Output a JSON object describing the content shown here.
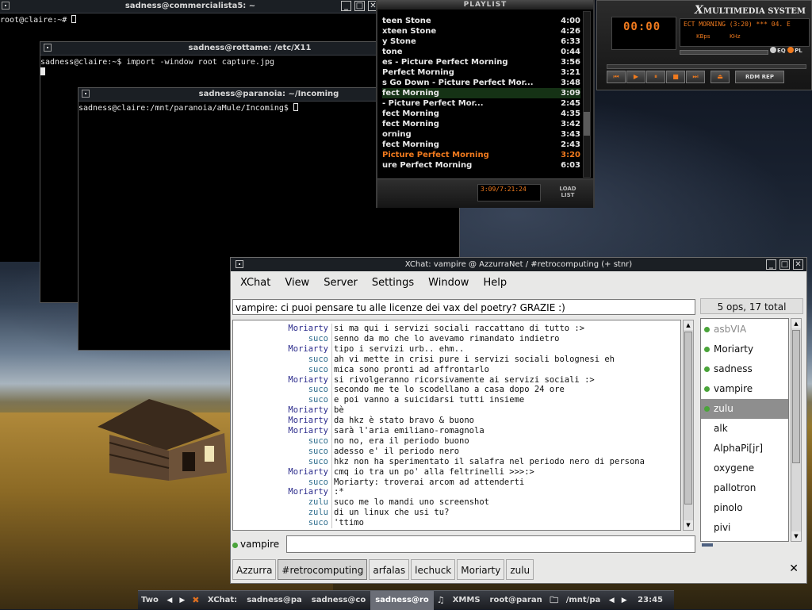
{
  "colors": {
    "accent": "#f07a1e",
    "nick_blue": "#2c2c8c",
    "nick_teal": "#2f6e8e",
    "online_dot": "#4aa43a",
    "titlebar": "#1b1f24"
  },
  "terminals": [
    {
      "title": "sadness@commercialista5: ~",
      "lines": [
        "root@claire:~# "
      ]
    },
    {
      "title": "sadness@rottame: /etc/X11",
      "lines": [
        "sadness@claire:~$ import -window root capture.jpg"
      ]
    },
    {
      "title": "sadness@paranoia: ~/Incoming",
      "lines": [
        "sadness@claire:/mnt/paranoia/aMule/Incoming$ "
      ]
    }
  ],
  "playlist": {
    "title": "PLAYLIST",
    "rows": [
      {
        "t": "teen Stone",
        "d": "4:00"
      },
      {
        "t": "xteen Stone",
        "d": "4:26"
      },
      {
        "t": "y Stone",
        "d": "6:33"
      },
      {
        "t": "tone",
        "d": "0:44"
      },
      {
        "t": "es - Picture Perfect Morning",
        "d": "3:56"
      },
      {
        "t": "Perfect Morning",
        "d": "3:21"
      },
      {
        "t": "s Go Down - Picture Perfect Mor...",
        "d": "3:48"
      },
      {
        "t": "fect Morning",
        "d": "3:09"
      },
      {
        "t": "- Picture Perfect Mor...",
        "d": "2:45"
      },
      {
        "t": "fect Morning",
        "d": "4:35"
      },
      {
        "t": "fect Morning",
        "d": "3:42"
      },
      {
        "t": "orning",
        "d": "3:43"
      },
      {
        "t": "fect Morning",
        "d": "2:43"
      },
      {
        "t": "Picture Perfect Morning",
        "d": "3:20"
      },
      {
        "t": "ure Perfect Morning",
        "d": "6:03"
      }
    ],
    "time_display": "3:09/7:21:24",
    "load_label": "LOAD",
    "list_label": "LIST"
  },
  "xmms": {
    "title_x": "X",
    "title_rest": "MULTIMEDIA SYSTEM",
    "time": "00:00",
    "song": "ECT MORNING (3:20) *** 04. E",
    "kbps_label": "KBps",
    "khz_label": "KHz",
    "eq_label": "EQ",
    "pl_label": "PL",
    "rdm_rep": "RDM   REP",
    "controls": [
      "⏮",
      "▶",
      "⏸",
      "■",
      "⏭",
      "⏏"
    ]
  },
  "xchat": {
    "title": "XChat: vampire @ AzzurraNet / #retrocomputing (+ stnr)",
    "menu": [
      "XChat",
      "View",
      "Server",
      "Settings",
      "Window",
      "Help"
    ],
    "topic": "vampire: ci puoi pensare tu alle licenze dei vax del poetry? GRAZIE :)",
    "ops_summary": "5 ops, 17 total",
    "messages": [
      {
        "nick": "Moriarty",
        "color": "blue",
        "text": "si ma qui i servizi sociali raccattano di tutto :>"
      },
      {
        "nick": "suco",
        "color": "teal",
        "text": "senno da mo che lo avevamo rimandato indietro"
      },
      {
        "nick": "Moriarty",
        "color": "blue",
        "text": "tipo i servizi urb.. ehm.."
      },
      {
        "nick": "suco",
        "color": "teal",
        "text": "ah vi mette in crisi pure i servizi sociali bolognesi eh"
      },
      {
        "nick": "suco",
        "color": "teal",
        "text": "mica sono pronti ad affrontarlo"
      },
      {
        "nick": "Moriarty",
        "color": "blue",
        "text": "si rivolgeranno ricorsivamente ai servizi sociali :>"
      },
      {
        "nick": "suco",
        "color": "teal",
        "text": "secondo me te lo scodellano a casa dopo 24 ore"
      },
      {
        "nick": "suco",
        "color": "teal",
        "text": "e poi vanno a suicidarsi tutti insieme"
      },
      {
        "nick": "Moriarty",
        "color": "blue",
        "text": "bè"
      },
      {
        "nick": "Moriarty",
        "color": "blue",
        "text": "da hkz è stato bravo & buono"
      },
      {
        "nick": "Moriarty",
        "color": "blue",
        "text": "sarà l'aria emiliano-romagnola"
      },
      {
        "nick": "suco",
        "color": "teal",
        "text": "no no, era il periodo buono"
      },
      {
        "nick": "suco",
        "color": "teal",
        "text": "adesso e' il periodo nero"
      },
      {
        "nick": "suco",
        "color": "teal",
        "text": "hkz non ha sperimentato il salafra nel periodo nero di persona"
      },
      {
        "nick": "Moriarty",
        "color": "blue",
        "text": "cmq io tra un po' alla feltrinelli >>>:>"
      },
      {
        "nick": "suco",
        "color": "teal",
        "text": "Moriarty: troverai arcom ad attenderti"
      },
      {
        "nick": "Moriarty",
        "color": "blue",
        "text": ":*"
      },
      {
        "nick": "zulu",
        "color": "teal",
        "text": "suco me lo mandi uno screenshot"
      },
      {
        "nick": "zulu",
        "color": "teal",
        "text": "di un linux che usi tu?"
      },
      {
        "nick": "suco",
        "color": "teal",
        "text": "'ttimo"
      }
    ],
    "users": [
      {
        "name": "asbVIA",
        "dot": true,
        "away": true
      },
      {
        "name": "Moriarty",
        "dot": true
      },
      {
        "name": "sadness",
        "dot": true
      },
      {
        "name": "vampire",
        "dot": true
      },
      {
        "name": "zulu",
        "dot": true,
        "selected": true
      },
      {
        "name": "alk"
      },
      {
        "name": "AlphaPi[jr]"
      },
      {
        "name": "oxygene"
      },
      {
        "name": "pallotron"
      },
      {
        "name": "pinolo"
      },
      {
        "name": "pivi"
      }
    ],
    "input_nick": "vampire",
    "input_value": "",
    "tabs": [
      "Azzurra",
      "#retrocomputing",
      "arfalas",
      "lechuck",
      "Moriarty",
      "zulu"
    ],
    "active_tab": "#retrocomputing",
    "close_glyph": "✕"
  },
  "taskbar": {
    "desktop": "Two",
    "tasks": [
      {
        "label": "XChat:",
        "icon": "xchat-icon"
      },
      {
        "label": "sadness@pa"
      },
      {
        "label": "sadness@co"
      },
      {
        "label": "sadness@ro",
        "active": true
      },
      {
        "label": "XMMS",
        "icon": "xmms-icon"
      },
      {
        "label": "root@paran"
      },
      {
        "label": "/mnt/pa",
        "icon": "folder-icon"
      }
    ],
    "clock": "23:45"
  }
}
